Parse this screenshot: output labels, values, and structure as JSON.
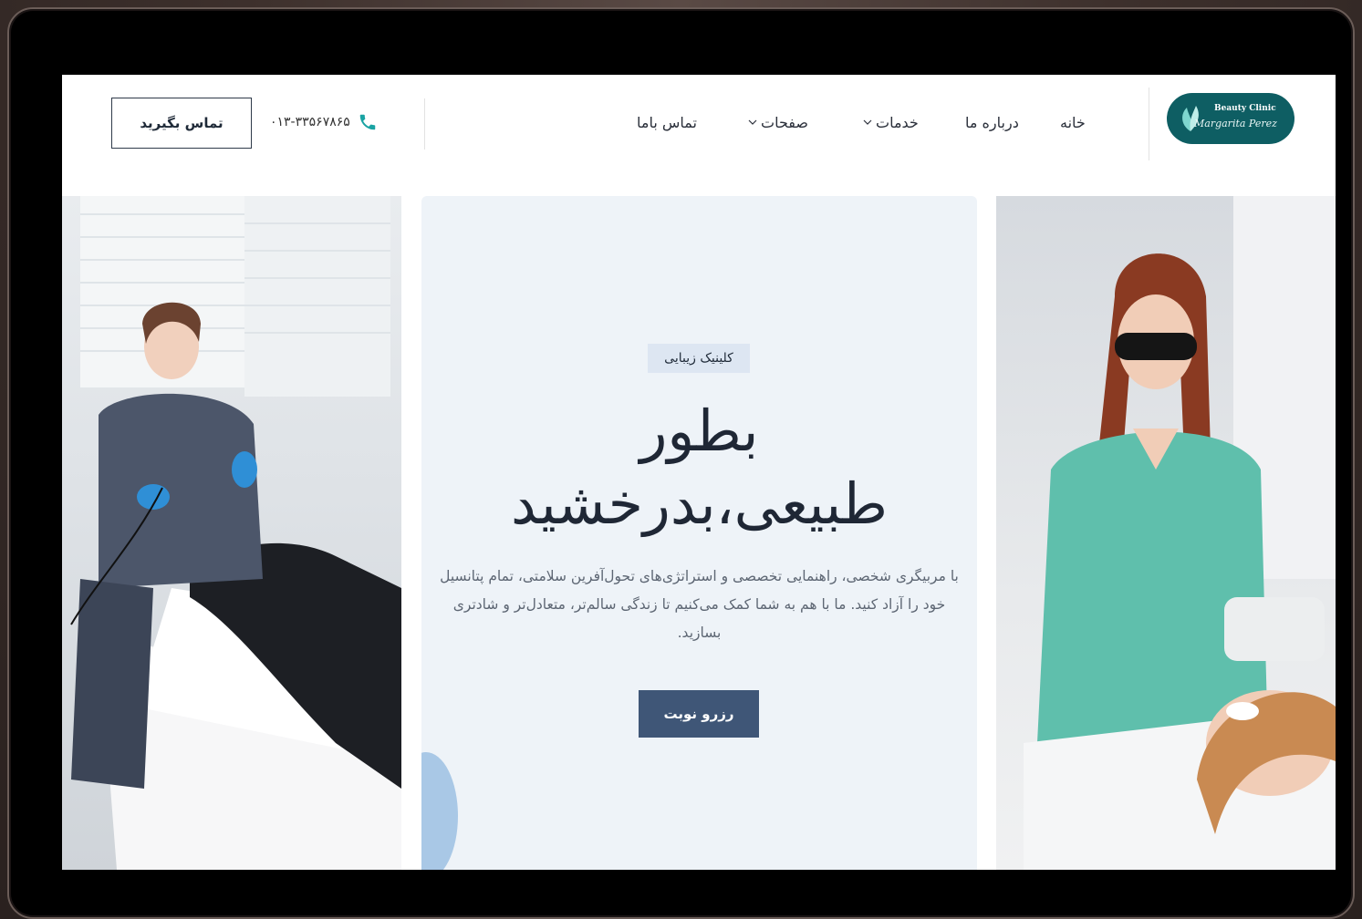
{
  "header": {
    "logo": {
      "line1": "Beauty Clinic",
      "line2": "Margarita Perez"
    },
    "nav": [
      {
        "label": "خانه",
        "has_dropdown": false
      },
      {
        "label": "درباره ما",
        "has_dropdown": false
      },
      {
        "label": "خدمات",
        "has_dropdown": true
      },
      {
        "label": "صفحات",
        "has_dropdown": true
      },
      {
        "label": "تماس باما",
        "has_dropdown": false
      }
    ],
    "phone": "۰۱۳-۳۳۵۶۷۸۶۵",
    "cta_label": "تماس بگیرید"
  },
  "hero": {
    "badge": "کلینیک زیبایی",
    "headline_line1": "بطور",
    "headline_line2": "طبیعی،بدرخشید",
    "description": "با مربیگری شخصی، راهنمایی تخصصی و استراتژی‌های تحول‌آفرین سلامتی، تمام پتانسیل خود را آزاد کنید. ما با هم به شما کمک می‌کنیم تا زندگی سالم‌تر، متعادل‌تر و شادتری بسازید.",
    "button_label": "رزرو نوبت"
  },
  "colors": {
    "brand_dark": "#3f5677",
    "logo_teal": "#0e5e63",
    "card_bg": "#eef3f8",
    "phone_icon": "#1aa3a3"
  },
  "icons": {
    "phone": "phone-icon",
    "dropdown": "chevron-down-icon"
  }
}
